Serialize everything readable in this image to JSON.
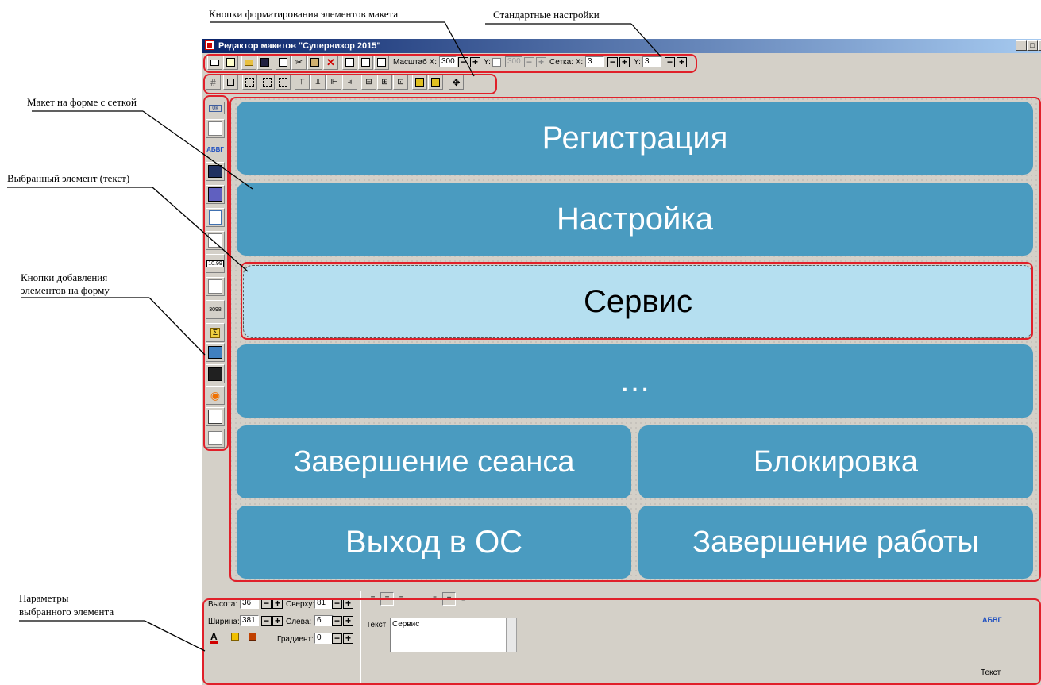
{
  "annotations": {
    "format_buttons": "Кнопки форматирования элементов макета",
    "standard_settings": "Стандартные настройки",
    "layout_grid": "Макет на форме с сеткой",
    "selected_element": "Выбранный элемент (текст)",
    "add_buttons_line1": "Кнопки добавления",
    "add_buttons_line2": "элементов на форму",
    "params_line1": "Параметры",
    "params_line2": "выбранного элемента"
  },
  "window": {
    "title": "Редактор макетов \"Супервизор 2015\"",
    "controls": [
      "_",
      "□",
      "x"
    ]
  },
  "toolbar": {
    "scale_label": "Масштаб X:",
    "scale_x": "300",
    "scale_y_label": "Y:",
    "scale_y": "300",
    "grid_label": "Сетка: X:",
    "grid_x": "3",
    "grid_y_label": "Y:",
    "grid_y": "3",
    "minus": "−",
    "plus": "+"
  },
  "left_panel": {
    "ok_label": "0k",
    "text_label": "АБВГ",
    "number_label": "10.99",
    "counter_label": "3098"
  },
  "layout_tiles": [
    {
      "label": "Регистрация"
    },
    {
      "label": "Настройка"
    },
    {
      "label": "Сервис"
    },
    {
      "label": "…"
    },
    {
      "label": "Завершение сеанса"
    },
    {
      "label": "Блокировка"
    },
    {
      "label": "Выход в ОС"
    },
    {
      "label": "Завершение работы"
    }
  ],
  "params": {
    "height_label": "Высота:",
    "height": "36",
    "top_label": "Сверху:",
    "top": "81",
    "width_label": "Ширина:",
    "width": "381",
    "left_label": "Слева:",
    "left": "6",
    "gradient_label": "Градиент:",
    "gradient": "0",
    "text_label": "Текст:",
    "text_value": "Сервис",
    "preview_label": "АБВГ",
    "preview_caption": "Текст"
  },
  "colors": {
    "tile": "#4a9bc0",
    "tile_selected": "#b5dff0",
    "highlight": "#e0202a"
  }
}
